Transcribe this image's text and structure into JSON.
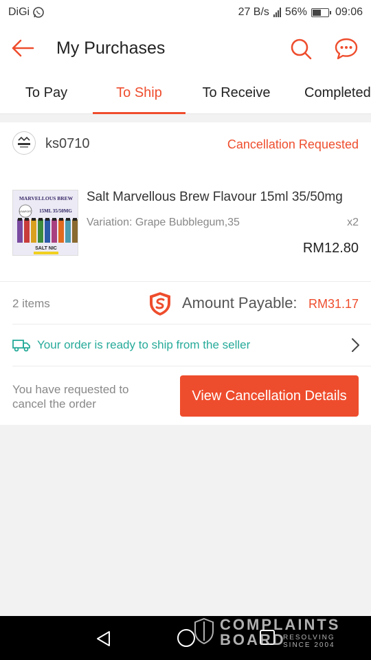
{
  "status_bar": {
    "carrier": "DiGi",
    "network_speed": "27 B/s",
    "battery_percent": "56%",
    "battery_level": 0.56,
    "time": "09:06"
  },
  "header": {
    "title": "My Purchases",
    "back_icon": "arrow-left-icon",
    "search_icon": "search-icon",
    "chat_icon": "chat-icon"
  },
  "tabs": [
    {
      "label": "To Pay",
      "active": false
    },
    {
      "label": "To Ship",
      "active": true
    },
    {
      "label": "To Receive",
      "active": false
    },
    {
      "label": "Completed",
      "active": false
    }
  ],
  "order": {
    "shop_name": "ks0710",
    "status": "Cancellation Requested",
    "product": {
      "name": "Salt Marvellous Brew Flavour 15ml 35/50mg",
      "variation": "Variation: Grape Bubblegum,35",
      "quantity": "x2",
      "price": "RM12.80",
      "thumb_text": {
        "brand": "MARVELLOUS BREW",
        "shop": "VIVAPORT",
        "size": "15ML 35/50MG",
        "type": "SALT NIC"
      }
    },
    "items_count": "2 items",
    "payable_label": "Amount Payable:",
    "payable_value": "RM31.17",
    "shipping_text": "Your order is ready to ship from the seller",
    "cancel_note": "You have requested to cancel the order",
    "cancel_button": "View Cancellation Details"
  },
  "watermark": {
    "line1": "COMPLAINTS",
    "line2": "BOARD",
    "line3": "RESOLVING SINCE 2004"
  },
  "colors": {
    "accent": "#ee4d2d",
    "shipping_green": "#26aa99"
  }
}
